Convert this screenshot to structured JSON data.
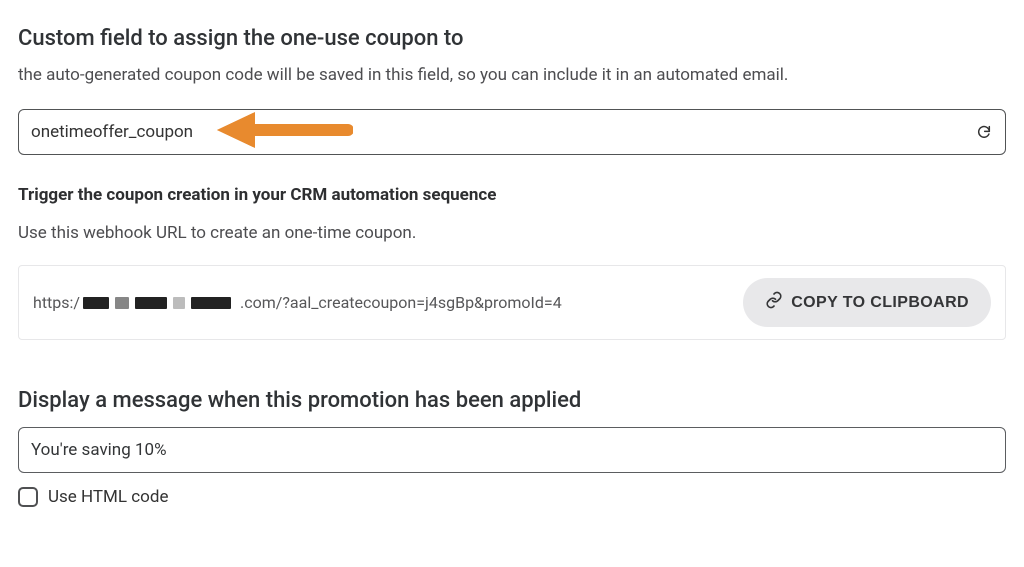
{
  "customField": {
    "title": "Custom field to assign the one-use coupon to",
    "description": "the auto-generated coupon code will be saved in this field, so you can include it in an automated email.",
    "value": "onetimeoffer_coupon"
  },
  "trigger": {
    "title": "Trigger the coupon creation in your CRM automation sequence",
    "description": "Use this webhook URL to create an one-time coupon.",
    "urlPrefix": "https:/",
    "urlSuffix": ".com/?aal_createcoupon=j4sgBp&promoId=4",
    "copyLabel": "COPY TO CLIPBOARD"
  },
  "displayMessage": {
    "title": "Display a message when this promotion has been applied",
    "value": "You're saving 10%",
    "checkboxLabel": "Use HTML code"
  }
}
